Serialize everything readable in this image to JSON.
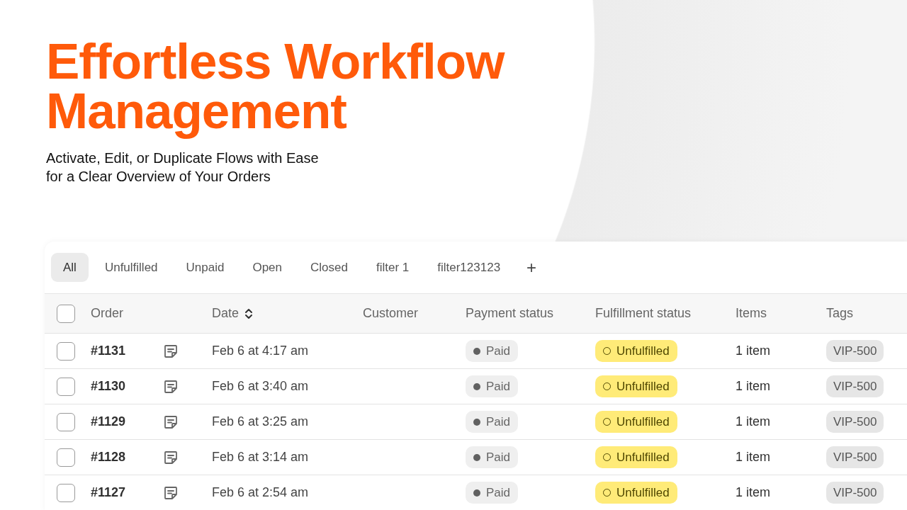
{
  "headline": "Effortless Workflow Management",
  "subheadline": [
    "Activate, Edit, or Duplicate Flows with Ease",
    "for a Clear Overview of Your Orders"
  ],
  "tabs": [
    {
      "label": "All",
      "selected": true
    },
    {
      "label": "Unfulfilled",
      "selected": false
    },
    {
      "label": "Unpaid",
      "selected": false
    },
    {
      "label": "Open",
      "selected": false
    },
    {
      "label": "Closed",
      "selected": false
    },
    {
      "label": "filter 1",
      "selected": false
    },
    {
      "label": "filter123123",
      "selected": false
    }
  ],
  "add_tab": "+",
  "table": {
    "select_all_checked": false,
    "columns": [
      {
        "label": "Order",
        "sortable": false
      },
      {
        "label": "Date",
        "sortable": true
      },
      {
        "label": "Customer",
        "sortable": false
      },
      {
        "label": "Payment status",
        "sortable": false
      },
      {
        "label": "Fulfillment status",
        "sortable": false
      },
      {
        "label": "Items",
        "sortable": false
      },
      {
        "label": "Tags",
        "sortable": false
      }
    ],
    "rows": [
      {
        "checked": false,
        "order": "#1131",
        "has_note": true,
        "date": "Feb 6 at 4:17 am",
        "payment_status": "Paid",
        "fulfillment_status": "Unfulfilled",
        "items": "1 item",
        "tags": "VIP-500"
      },
      {
        "checked": false,
        "order": "#1130",
        "has_note": true,
        "date": "Feb 6 at 3:40 am",
        "payment_status": "Paid",
        "fulfillment_status": "Unfulfilled",
        "items": "1 item",
        "tags": "VIP-500"
      },
      {
        "checked": false,
        "order": "#1129",
        "has_note": true,
        "date": "Feb 6 at 3:25 am",
        "payment_status": "Paid",
        "fulfillment_status": "Unfulfilled",
        "items": "1 item",
        "tags": "VIP-500"
      },
      {
        "checked": false,
        "order": "#1128",
        "has_note": true,
        "date": "Feb 6 at 3:14 am",
        "payment_status": "Paid",
        "fulfillment_status": "Unfulfilled",
        "items": "1 item",
        "tags": "VIP-500"
      },
      {
        "checked": false,
        "order": "#1127",
        "has_note": true,
        "date": "Feb 6 at 2:54 am",
        "payment_status": "Paid",
        "fulfillment_status": "Unfulfilled",
        "items": "1 item",
        "tags": "VIP-500"
      }
    ]
  }
}
